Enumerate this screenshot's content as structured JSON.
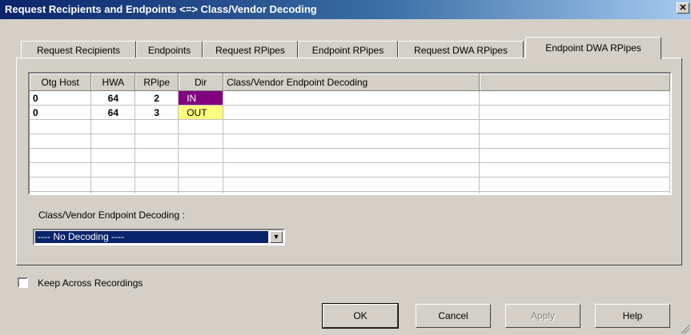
{
  "window": {
    "title": "Request Recipients and Endpoints <=> Class/Vendor Decoding",
    "close_label": "✕"
  },
  "tabs": [
    {
      "label": "Request Recipients",
      "active": false
    },
    {
      "label": "Endpoints",
      "active": false
    },
    {
      "label": "Request RPipes",
      "active": false
    },
    {
      "label": "Endpoint RPipes",
      "active": false
    },
    {
      "label": "Request DWA RPipes",
      "active": false
    },
    {
      "label": "Endpoint DWA RPipes",
      "active": true
    }
  ],
  "table": {
    "columns": [
      "Otg Host",
      "HWA",
      "RPipe",
      "Dir",
      "Class/Vendor Endpoint Decoding",
      ""
    ],
    "rows": [
      {
        "otg_host": "0",
        "hwa": "64",
        "rpipe": "2",
        "dir": "IN",
        "decoding": ""
      },
      {
        "otg_host": "0",
        "hwa": "64",
        "rpipe": "3",
        "dir": "OUT",
        "decoding": ""
      }
    ]
  },
  "decoding": {
    "label": "Class/Vendor Endpoint Decoding :",
    "selected": "---- No Decoding ----"
  },
  "keep_across": {
    "label": "Keep Across Recordings",
    "checked": false
  },
  "buttons": {
    "ok": "OK",
    "cancel": "Cancel",
    "apply": "Apply",
    "help": "Help"
  },
  "colors": {
    "dir_in_bg": "#800080",
    "dir_out_bg": "#ffff80",
    "titlebar": "#0a246a"
  }
}
